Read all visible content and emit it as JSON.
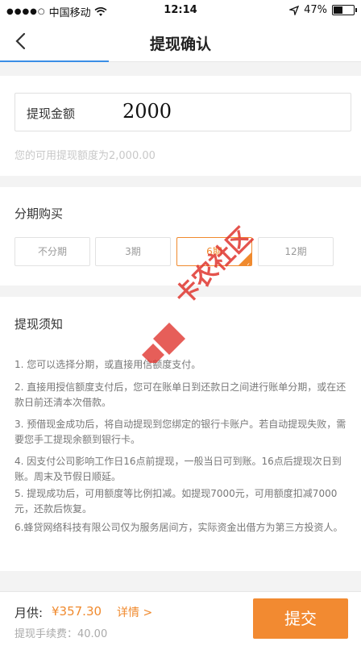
{
  "status_bar": {
    "signal": "●●●●○",
    "carrier": "中国移动",
    "time": "12:14",
    "battery": "47%"
  },
  "nav": {
    "title": "提现确认",
    "back_icon": "back-arrow-icon"
  },
  "amount": {
    "label": "提现金额",
    "value": "2000",
    "available_text": "您的可用提现额度为2,000.00"
  },
  "installment": {
    "title": "分期购买",
    "options": [
      "不分期",
      "3期",
      "6期",
      "12期"
    ],
    "selected": "6期"
  },
  "notice": {
    "title": "提现须知",
    "items": [
      "1. 您可以选择分期，或直接用信额度支付。",
      "2. 直接用授信额度支付后，您可在账单日到还款日之间进行账单分期，或在还款日前还清本次借款。",
      "3. 预借现金成功后，将自动提现到您绑定的银行卡账户。若自动提现失败，需要您手工提现余额到银行卡。",
      "4. 因支付公司影响工作日16点前提现，一般当日可到账。16点后提现次日到账。周末及节假日顺延。",
      "5. 提现成功后，可用额度等比例扣减。如提现7000元，可用额度扣减7000元，还款后恢复。",
      "6.蜂贷网络科技有限公司仅为服务居间方，实际资金出借方为第三方投资人。"
    ]
  },
  "bottom": {
    "monthly_label": "月供:",
    "monthly_value": "¥357.30",
    "details_label": "详情 >",
    "fee_text": "提现手续费：40.00",
    "submit_label": "提交"
  },
  "watermark": {
    "text": "卡农社区"
  },
  "colors": {
    "accent": "#f08a2e",
    "nav_progress": "#3a8ee6"
  }
}
